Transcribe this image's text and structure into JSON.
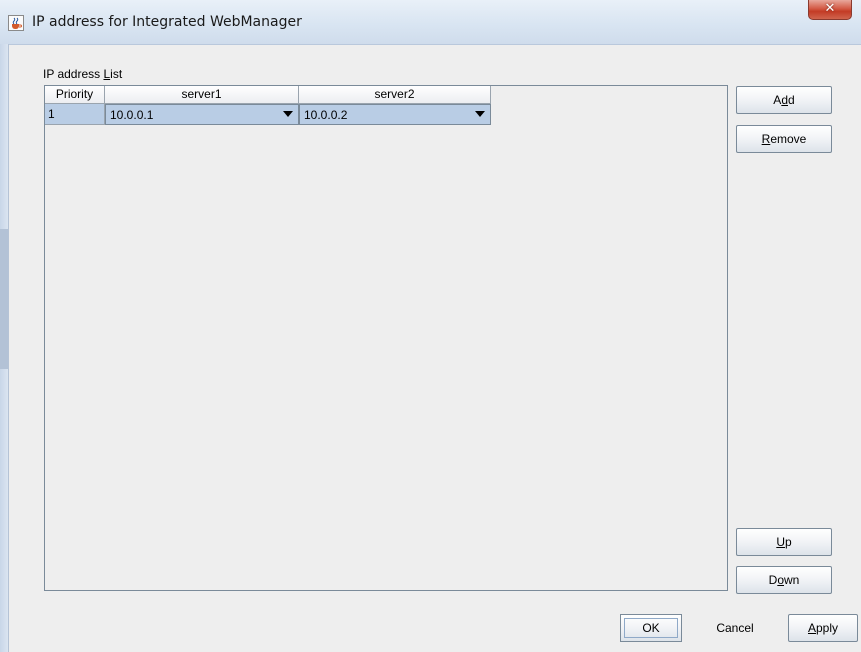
{
  "window": {
    "title": "IP address for Integrated WebManager",
    "close_glyph": "✕",
    "app_icon": "java-cup-icon"
  },
  "list": {
    "label_prefix": "IP address ",
    "label_mnemonic": "L",
    "label_suffix": "ist",
    "columns": [
      "Priority",
      "server1",
      "server2"
    ],
    "rows": [
      {
        "priority": "1",
        "server1": "10.0.0.1",
        "server2": "10.0.0.2"
      }
    ]
  },
  "side_buttons": {
    "add": {
      "pre": "A",
      "mnemonic": "d",
      "post": "d"
    },
    "remove": {
      "pre": "",
      "mnemonic": "R",
      "post": "emove"
    },
    "up": {
      "pre": "",
      "mnemonic": "U",
      "post": "p"
    },
    "down": {
      "pre": "D",
      "mnemonic": "o",
      "post": "wn"
    }
  },
  "footer": {
    "ok": "OK",
    "cancel": "Cancel",
    "apply": {
      "pre": "",
      "mnemonic": "A",
      "post": "pply"
    }
  },
  "colors": {
    "selection": "#b9cde5",
    "close_button": "#c33b25",
    "background": "#eeeeee"
  }
}
